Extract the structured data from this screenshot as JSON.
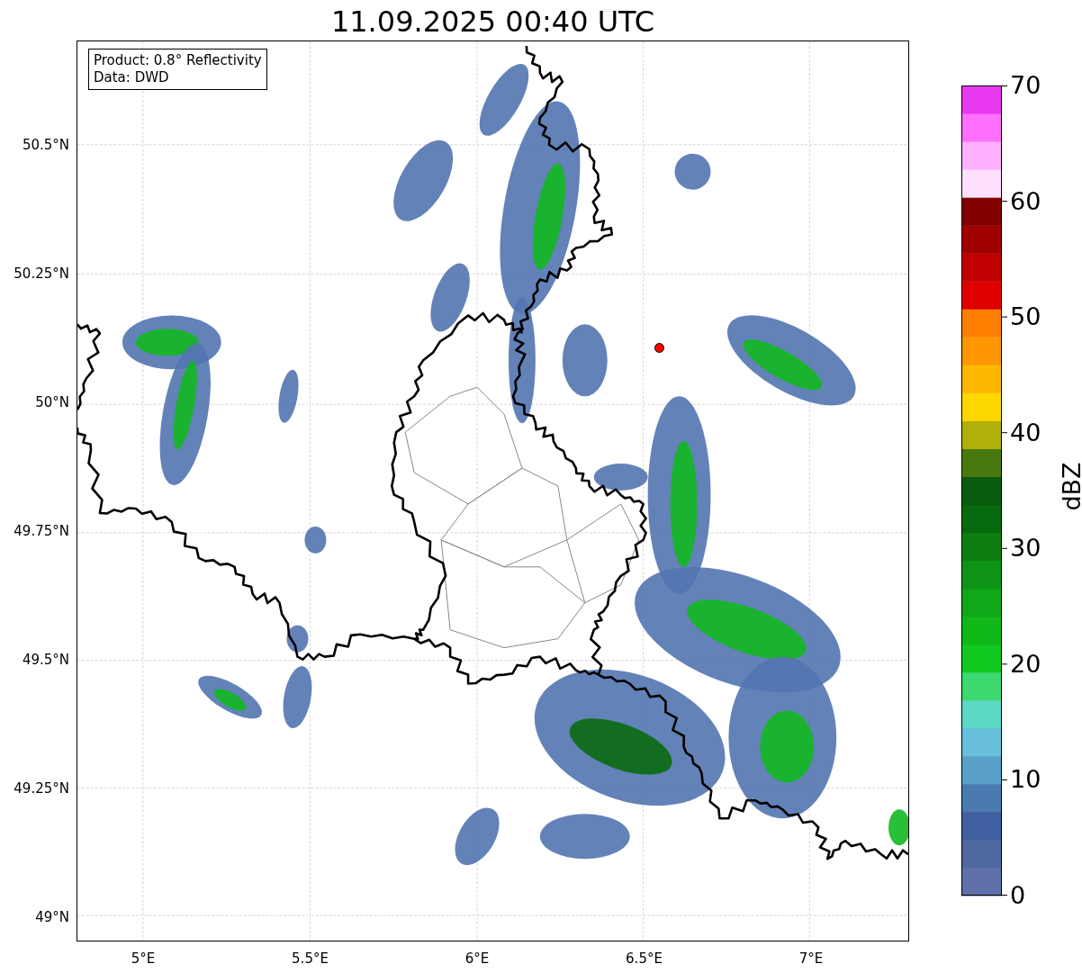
{
  "title": "11.09.2025 00:40 UTC",
  "info_box": [
    "Product: 0.8° Reflectivity",
    "Data: DWD"
  ],
  "lat_labels": [
    "50.5°N",
    "50.25°N",
    "50°N",
    "49.75°N",
    "49.5°N",
    "49.25°N",
    "49°N"
  ],
  "lon_labels": [
    "5°E",
    "5.5°E",
    "6°E",
    "6.5°E",
    "7°E"
  ],
  "colorbar": {
    "label": "dBZ",
    "tick_labels": [
      "70",
      "60",
      "50",
      "40",
      "30",
      "20",
      "10",
      "0"
    ]
  }
}
